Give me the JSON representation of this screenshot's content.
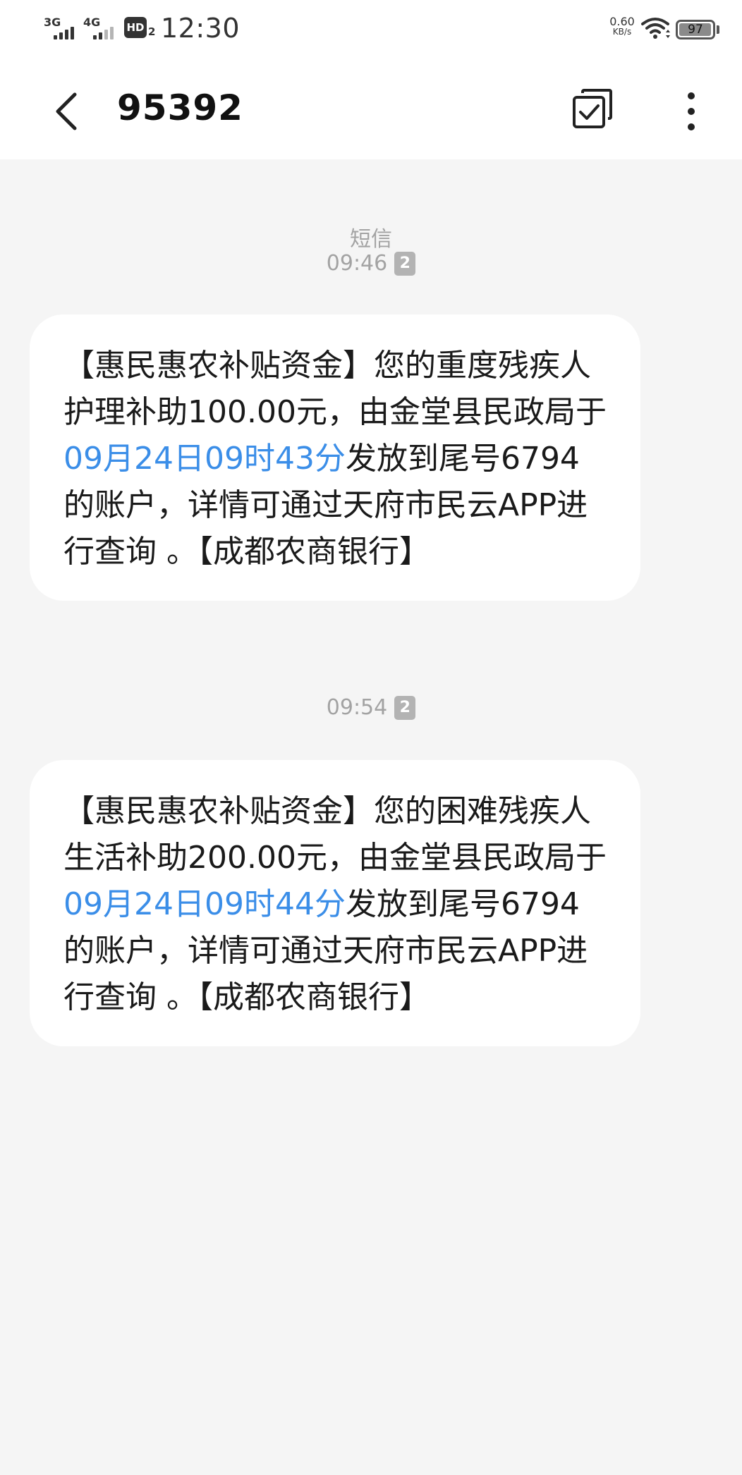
{
  "status_bar": {
    "net1": "3G",
    "net2": "4G",
    "hd": "HD",
    "hd_sub": "2",
    "time": "12:30",
    "speed_value": "0.60",
    "speed_unit": "KB/s",
    "battery_level": "97",
    "battery_fraction": 0.97
  },
  "title_bar": {
    "contact": "95392",
    "back_icon": "chevron-left-icon",
    "select_icon": "multi-select-icon",
    "more_icon": "more-vertical-icon"
  },
  "conversation": {
    "channel_label": "短信",
    "messages": [
      {
        "time": "09:46",
        "sim": "2",
        "text_before": "【惠民惠农补贴资金】您的重度残疾人护理补助100.00元，由金堂县民政局于",
        "link": "09月24日09时43分",
        "text_after": "发放到尾号6794的账户，详情可通过天府市民云APP进行查询 。【成都农商银行】"
      },
      {
        "time": "09:54",
        "sim": "2",
        "text_before": "【惠民惠农补贴资金】您的困难残疾人生活补助200.00元，由金堂县民政局于",
        "link": "09月24日09时44分",
        "text_after": "发放到尾号6794的账户，详情可通过天府市民云APP进行查询 。【成都农商银行】"
      }
    ]
  },
  "colors": {
    "background": "#f5f5f5",
    "bubble": "#ffffff",
    "link": "#3b8ee8",
    "meta_text": "#a3a3a3"
  }
}
